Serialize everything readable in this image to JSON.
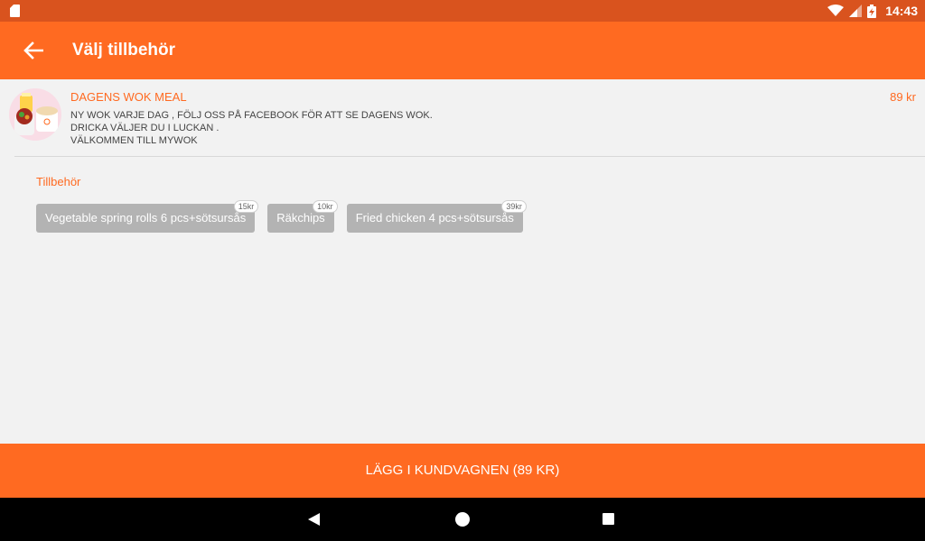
{
  "status_bar": {
    "time": "14:43",
    "icons": [
      "sd-card-icon",
      "wifi-icon",
      "signal-icon",
      "battery-charging-icon"
    ]
  },
  "app_bar": {
    "title": "Välj tillbehör",
    "back_icon": "arrow-back-icon"
  },
  "meal": {
    "name": "DAGENS WOK MEAL",
    "price": "89 kr",
    "description": [
      "NY WOK VARJE DAG , FÖLJ OSS PÅ FACEBOOK FÖR ATT SE DAGENS WOK.",
      "DRICKA VÄLJER DU I LUCKAN .",
      "VÄLKOMMEN TILL MYWOK"
    ]
  },
  "accessories": {
    "title": "Tillbehör",
    "items": [
      {
        "label": "Vegetable spring rolls 6 pcs+sötsursås",
        "price": "15kr"
      },
      {
        "label": "Räkchips",
        "price": "10kr"
      },
      {
        "label": "Fried chicken 4 pcs+sötsursås",
        "price": "39kr"
      }
    ]
  },
  "cart_button": {
    "label": "LÄGG I KUNDVAGNEN (89 KR)"
  },
  "colors": {
    "accent": "#ff6a21",
    "status_bar": "#d9531e",
    "chip": "#b3b3b3",
    "background": "#f2f2f2"
  }
}
